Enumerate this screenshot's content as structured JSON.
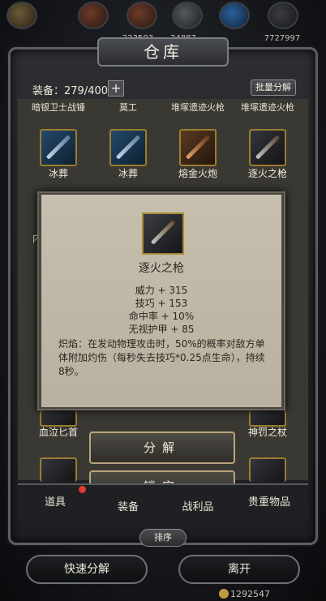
{
  "header": {
    "title": "仓库",
    "resources": [
      "223503",
      "24887",
      "7727997"
    ]
  },
  "inventory": {
    "count_label": "装备：279/400",
    "plus": "+",
    "batch_label": "批量分解",
    "top_row": [
      "暗银卫士战锤",
      "莫工",
      "堆塚遗迹火枪",
      "堆塚遗迹火枪"
    ],
    "row2": [
      "冰葬",
      "冰葬",
      "熔金火炮",
      "逐火之枪"
    ],
    "bottom_row": [
      "血泣匕首",
      "",
      "",
      "神罚之杖"
    ],
    "left_clip": "内"
  },
  "popup": {
    "item_name": "逐火之枪",
    "stats": [
      "威力 + 315",
      "技巧 + 153",
      "命中率 + 10%",
      "无视护甲 + 85"
    ],
    "description": "炽焰：在发动物理攻击时，50%的概率对敌方单体附加灼伤（每秒失去技巧*0.25点生命），持续8秒。",
    "decompose": "分解",
    "lock": "锁定"
  },
  "tabs": [
    "道具",
    "装备",
    "战利品",
    "贵重物品"
  ],
  "sort": "排序",
  "actions": {
    "quick_decompose": "快速分解",
    "leave": "离开"
  },
  "gold": "1292547",
  "colors": {
    "frame": "#5c5f64",
    "slot_border": "#9a7d2e",
    "popup_bg": "#c6bfae",
    "red_dot": "#e23a2e"
  }
}
